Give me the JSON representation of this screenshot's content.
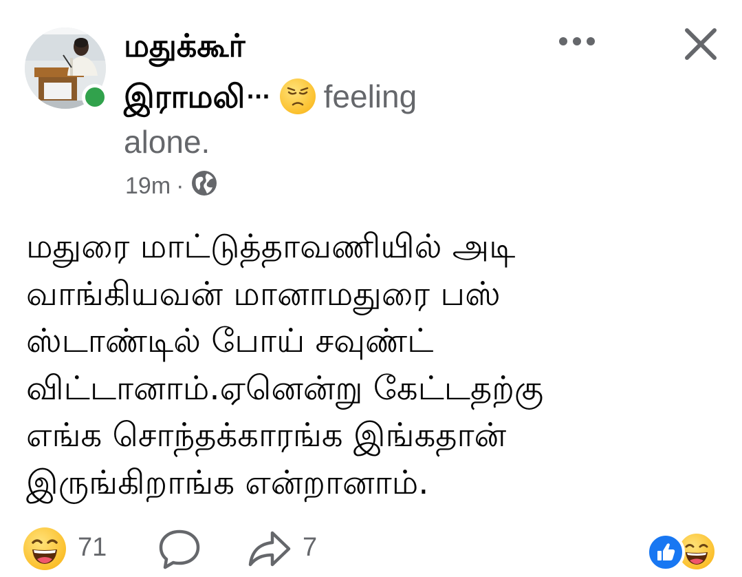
{
  "post": {
    "author_line1": "மதுக்கூர்",
    "author_line2": "இராமலி",
    "author_ellipsis": "...",
    "feeling_emoji_icon": "sad-face-emoji",
    "feeling_word": "feeling",
    "feeling_state": "alone.",
    "timestamp": "19m",
    "separator": "·",
    "audience_icon": "globe-icon",
    "online_status_color": "#31a24c",
    "body_lines": [
      "மதுரை மாட்டுத்தாவணியில் அடி",
      "வாங்கியவன் மானாமதுரை பஸ்",
      "ஸ்டாண்டில் போய் சவுண்ட்",
      "விட்டானாம்.ஏனென்று கேட்டதற்கு",
      "எங்க சொந்தக்காரங்க இங்கதான்",
      "இருங்கிறாங்க என்றானாம்."
    ]
  },
  "footer": {
    "reaction_emoji_icon": "haha-emoji",
    "reaction_count": "71",
    "comment_icon": "comment-bubble-icon",
    "share_icon": "share-arrow-icon",
    "share_count": "7",
    "summary_reactions": [
      "like-icon",
      "haha-emoji"
    ]
  },
  "colors": {
    "like_blue": "#1877f2",
    "secondary_text": "#65676b",
    "primary_text": "#050505"
  }
}
